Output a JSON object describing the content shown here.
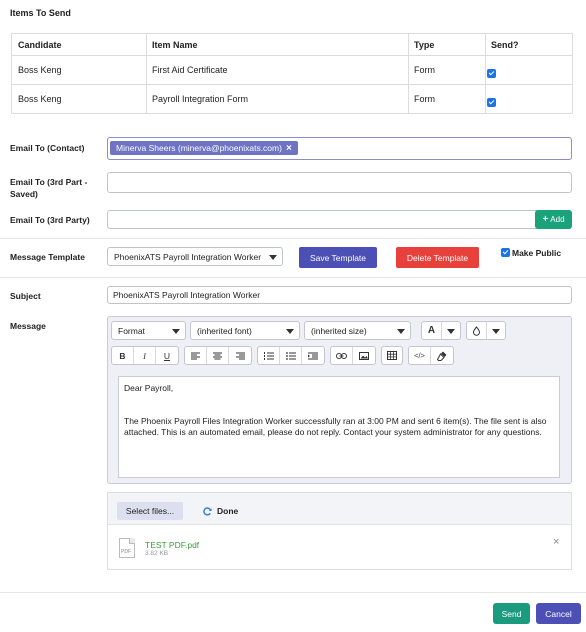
{
  "title": "Items To Send",
  "table": {
    "headers": [
      "Candidate",
      "Item Name",
      "Type",
      "Send?"
    ],
    "rows": [
      {
        "candidate": "Boss Keng",
        "item": "First Aid Certificate",
        "type": "Form",
        "send": true
      },
      {
        "candidate": "Boss Keng",
        "item": "Payroll Integration Form",
        "type": "Form",
        "send": true
      }
    ]
  },
  "email_to_contact": {
    "label": "Email To (Contact)",
    "chip": "Minerva Sheers (minerva@phoenixats.com)",
    "chip_remove": "×"
  },
  "email_to_3rd_saved": {
    "label": "Email To (3rd Part - Saved)",
    "value": ""
  },
  "email_to_3rd_party": {
    "label": "Email To (3rd Party)",
    "value": "",
    "add_button": "Add"
  },
  "template": {
    "label": "Message Template",
    "selected": "PhoenixATS Payroll Integration Worker",
    "save_button": "Save Template",
    "delete_button": "Delete Template",
    "make_public_label": "Make Public",
    "make_public": true
  },
  "subject": {
    "label": "Subject",
    "value": "PhoenixATS Payroll Integration Worker"
  },
  "message": {
    "label": "Message",
    "toolbar": {
      "format": "Format",
      "font": "(inherited font)",
      "size": "(inherited size)"
    },
    "body_line1": "Dear Payroll,",
    "body_line2": "The Phoenix Payroll Files Integration Worker successfully ran at 3:00 PM and sent 6 item(s). The file sent is also attached. This is an automated email, please do not reply. Contact your system administrator for any questions."
  },
  "upload": {
    "select_button": "Select files...",
    "status": "Done",
    "file_name": "TEST PDF.pdf",
    "file_size": "3.82 KB",
    "file_ext": "PDF",
    "remove": "×"
  },
  "footer": {
    "send_button": "Send",
    "cancel_button": "Cancel"
  },
  "colors": {
    "accent_blue": "#4b4fb6",
    "danger_red": "#e8403a",
    "success_green": "#1a9b7d",
    "chip_purple": "#6e73c4"
  }
}
